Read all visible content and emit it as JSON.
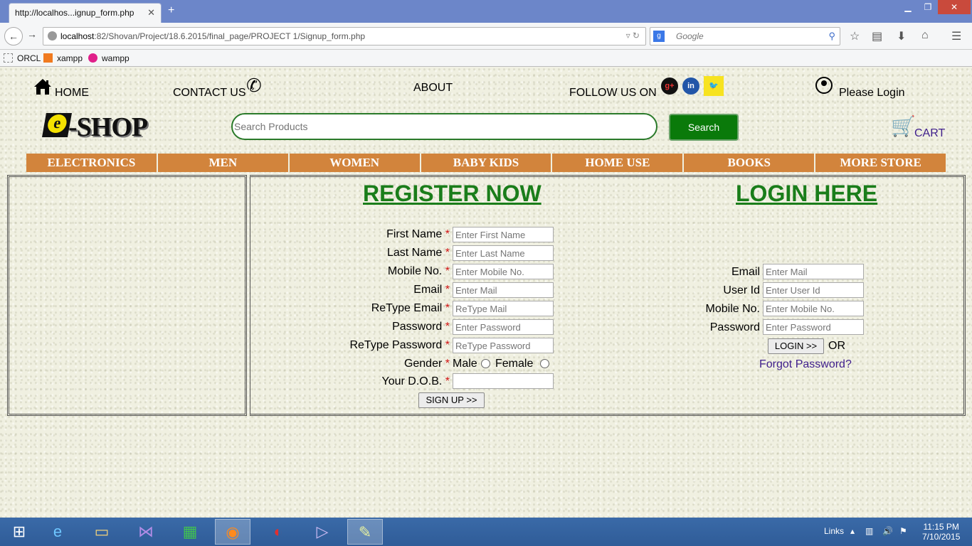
{
  "browser": {
    "tab_title": "http://localhos...ignup_form.php",
    "url_host": "localhost",
    "url_path": ":82/Shovan/Project/18.6.2015/final_page/PROJECT 1/Signup_form.php",
    "search_engine": "Google",
    "bookmarks": [
      "ORCL",
      "xampp",
      "wampp"
    ]
  },
  "header": {
    "home": "HOME",
    "contact": "CONTACT US",
    "about": "ABOUT",
    "follow": "FOLLOW US ON",
    "login": "Please Login",
    "logo_text": "-SHOP",
    "search_placeholder": "Search Products",
    "search_button": "Search",
    "cart": "CART"
  },
  "categories": [
    "ELECTRONICS",
    "MEN",
    "WOMEN",
    "BABY KIDS",
    "HOME USE",
    "BOOKS",
    "MORE STORE"
  ],
  "register": {
    "title": "REGISTER NOW",
    "first_name_label": "First Name",
    "first_name_ph": "Enter First Name",
    "last_name_label": "Last Name",
    "last_name_ph": "Enter Last Name",
    "mobile_label": "Mobile No.",
    "mobile_ph": "Enter Mobile No.",
    "email_label": "Email",
    "email_ph": "Enter Mail",
    "retype_email_label": "ReType Email",
    "retype_email_ph": "ReType Mail",
    "password_label": "Password",
    "password_ph": "Enter Password",
    "retype_password_label": "ReType Password",
    "retype_password_ph": "ReType Password",
    "gender_label": "Gender",
    "male": "Male",
    "female": "Female",
    "dob_label": "Your D.O.B.",
    "required_mark": "*",
    "signup_button": "SIGN UP >>"
  },
  "login": {
    "title": "LOGIN HERE",
    "email_label": "Email",
    "email_ph": "Enter Mail",
    "userid_label": "User Id",
    "userid_ph": "Enter User Id",
    "mobile_label": "Mobile No.",
    "mobile_ph": "Enter Mobile No.",
    "password_label": "Password",
    "password_ph": "Enter Password",
    "login_button": "LOGIN >>",
    "or": "OR",
    "forgot": "Forgot Password?"
  },
  "taskbar": {
    "links": "Links",
    "time": "11:15 PM",
    "date": "7/10/2015"
  }
}
